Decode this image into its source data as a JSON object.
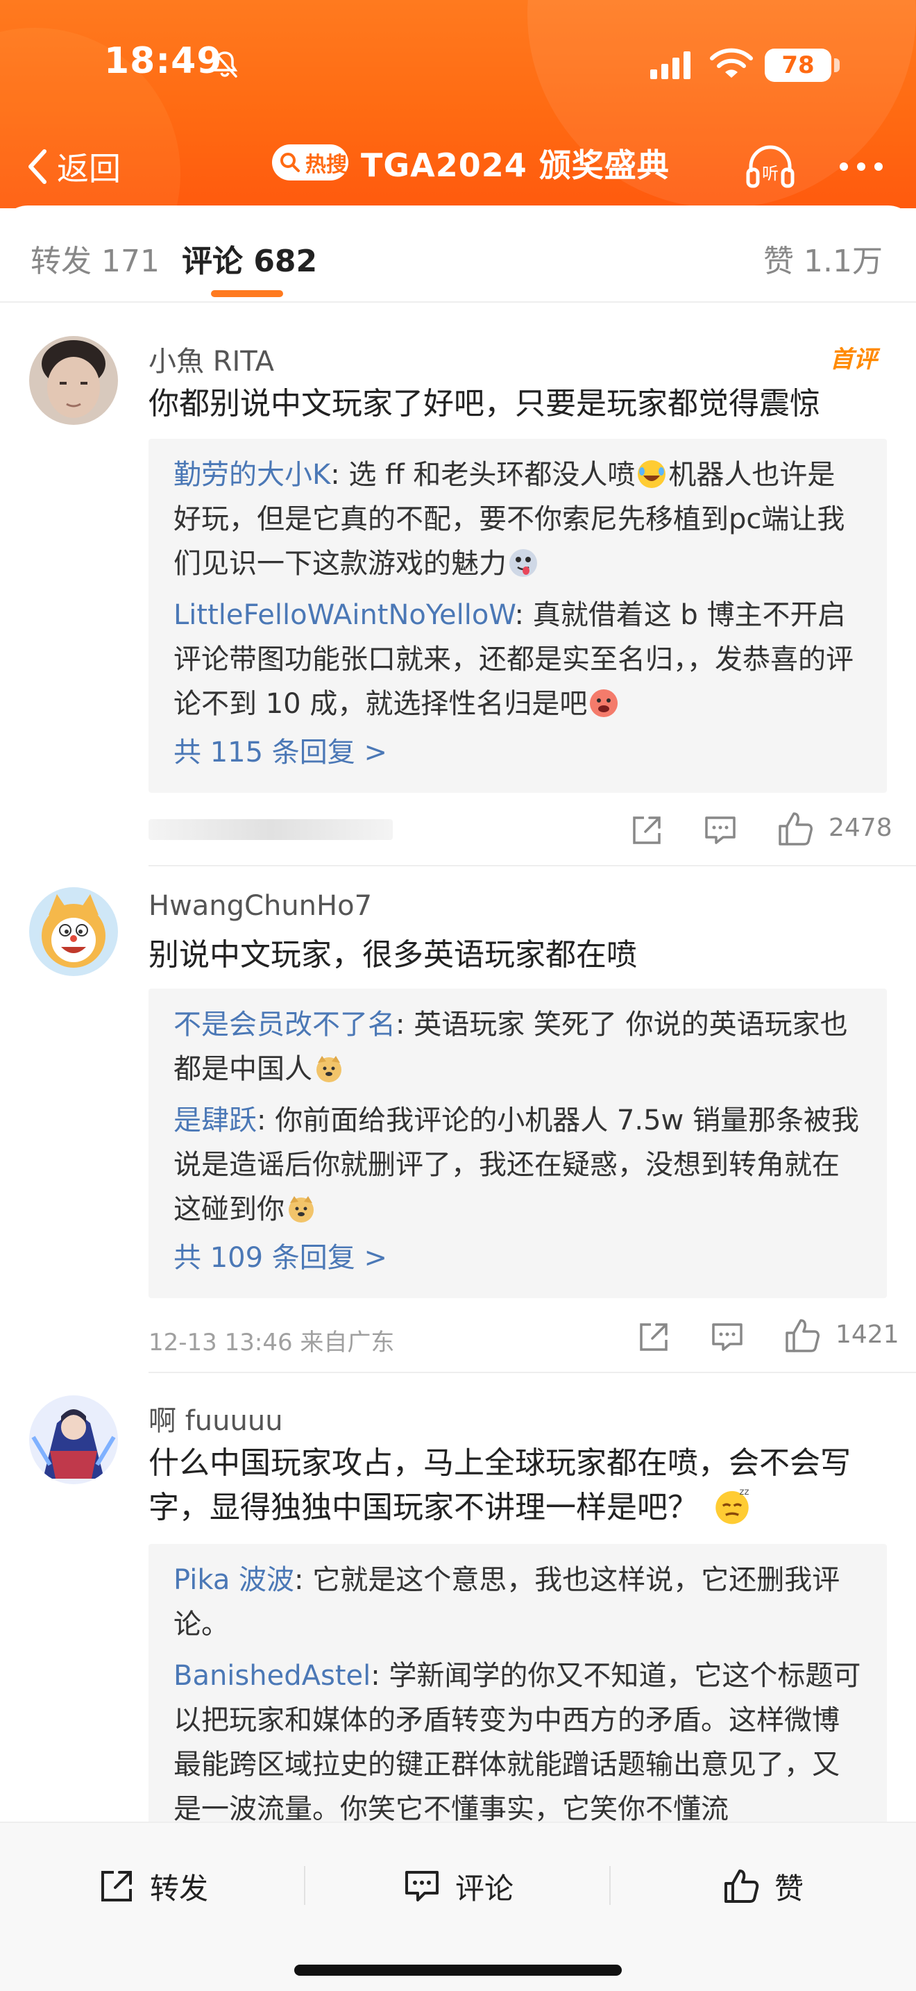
{
  "status_bar": {
    "time": "18:49",
    "battery": "78"
  },
  "nav": {
    "back_label": "返回",
    "hot_badge": "热搜",
    "title": "TGA2024 颁奖盛典"
  },
  "tabs": {
    "forward": "转发 171",
    "comment": "评论 682",
    "like": "赞 1.1万"
  },
  "comments": [
    {
      "username": "小魚 RITA",
      "badge": "首评",
      "text": "你都别说中文玩家了好吧，只要是玩家都觉得震惊",
      "replies": [
        {
          "name": "勤劳的大小K",
          "text_a": ": 选 ff 和老头环都没人喷",
          "text_b": "机器人也许是好玩，但是它真的不配，要不你索尼先移植到pc端让我们见识一下这款游戏的魅力"
        },
        {
          "name": "LittleFelloWAintNoYelloW",
          "text_a": ": 真就借着这 b 博主不开启评论带图功能张口就来，还都是实至名归，，发恭喜的评论不到 10 成，就选择性名归是吧",
          "text_b": ""
        }
      ],
      "more_replies": "共 115 条回复 >",
      "date": "",
      "like_count": "2478"
    },
    {
      "username": "HwangChunHo7",
      "text": "别说中文玩家，很多英语玩家都在喷",
      "replies": [
        {
          "name": "不是会员改不了名",
          "text_a": ": 英语玩家 笑死了 你说的英语玩家也都是中国人",
          "text_b": ""
        },
        {
          "name": "是肆跃",
          "text_a": ": 你前面给我评论的小机器人 7.5w 销量那条被我说是造谣后你就删评了，我还在疑惑，没想到转角就在这碰到你",
          "text_b": ""
        }
      ],
      "more_replies": "共 109 条回复 >",
      "date": "12-13 13:46  来自广东",
      "like_count": "1421"
    },
    {
      "username": "啊 fuuuuu",
      "text": "什么中国玩家攻占，马上全球玩家都在喷，会不会写字，显得独独中国玩家不讲理一样是吧？",
      "replies": [
        {
          "name": "Pika 波波",
          "text_a": ": 它就是这个意思，我也这样说，它还删我评论。",
          "text_b": ""
        },
        {
          "name": "BanishedAstel",
          "text_a": ": 学新闻学的你又不知道，它这个标题可以把玩家和媒体的矛盾转变为中西方的矛盾。这样微博最能跨区域拉史的键正群体就能蹭话题输出意见了，又是一波流量。你笑它不懂事实，它笑你不懂流",
          "text_b": ""
        }
      ]
    }
  ],
  "bottom_bar": {
    "forward": "转发",
    "comment": "评论",
    "like": "赞"
  },
  "colors": {
    "header": "#ff6a12",
    "accent": "#ff7a1f",
    "link": "#4b78b6",
    "badge": "#ff8a00"
  }
}
